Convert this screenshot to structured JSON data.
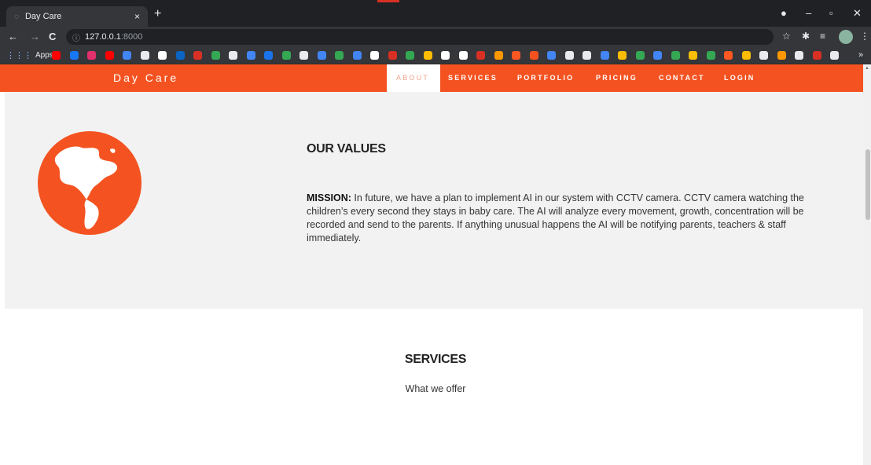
{
  "browser": {
    "tab_title": "Day Care",
    "tab_icon": "page-icon",
    "new_tab": "+",
    "close_tab": "×",
    "window_controls": {
      "minimize": "–",
      "maximize": "▫",
      "close": "✕"
    },
    "nav": {
      "back": "←",
      "forward": "→",
      "reload": "C"
    },
    "url_host": "127.0.0.1",
    "url_port": ":8000",
    "apps_label": "Apps",
    "bookmark_colors": [
      "#ff0000",
      "#1877f2",
      "#e1306c",
      "#ff0000",
      "#4285f4",
      "#e8eaed",
      "#ffffff",
      "#0a66c2",
      "#d93025",
      "#34a853",
      "#e8eaed",
      "#4285f4",
      "#1a73e8",
      "#34a853",
      "#e8eaed",
      "#4285f4",
      "#34a853",
      "#4285f4",
      "#ffffff",
      "#d93025",
      "#34a853",
      "#fbbc04",
      "#ffffff",
      "#ffffff",
      "#d93025",
      "#ff9800",
      "#ff5722",
      "#f4511e",
      "#4285f4",
      "#e8eaed",
      "#e8eaed",
      "#4285f4",
      "#fbbc04",
      "#34a853",
      "#4285f4",
      "#34a853",
      "#fbbc04",
      "#34a853",
      "#ff5722",
      "#fbbc04",
      "#e8eaed",
      "#ff9800",
      "#e8eaed",
      "#d93025",
      "#e8eaed"
    ],
    "more": "»"
  },
  "site": {
    "brand": "Day Care",
    "accent": "#f45321",
    "menu": [
      "ABOUT",
      "SERVICES",
      "PORTFOLIO",
      "PRICING",
      "CONTACT",
      "LOGIN"
    ],
    "active_menu": "ABOUT"
  },
  "values": {
    "icon": "globe-icon",
    "title": "OUR VALUES",
    "mission_label": "MISSION:",
    "mission_text": " In future, we have a plan to implement AI in our system with CCTV camera. CCTV camera watching the children’s every second they stays in baby care. The AI will analyze every movement, growth, concentration will be recorded and send to the parents. If anything unusual happens the AI will be notifying parents, teachers & staff immediately."
  },
  "services": {
    "title": "SERVICES",
    "subtitle": "What we offer"
  }
}
